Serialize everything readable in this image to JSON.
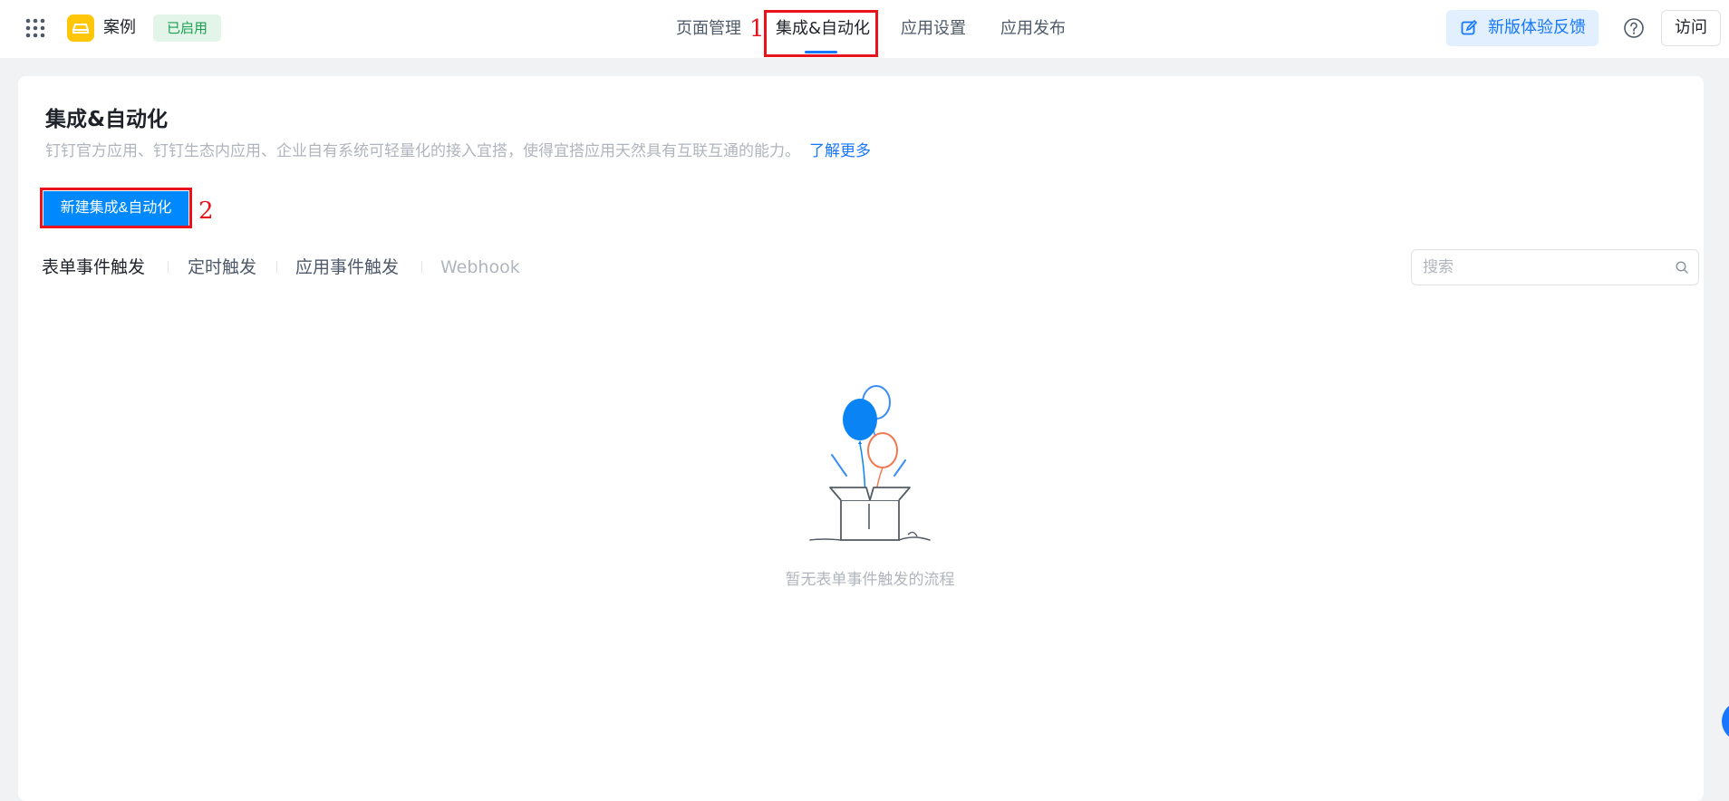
{
  "header": {
    "app_name": "案例",
    "status_badge": "已启用",
    "nav_tabs": [
      {
        "label": "页面管理"
      },
      {
        "label": "集成&自动化"
      },
      {
        "label": "应用设置"
      },
      {
        "label": "应用发布"
      }
    ],
    "feedback_label": "新版体验反馈",
    "visit_label": "访问"
  },
  "annotations": {
    "marker_1": "1",
    "marker_2": "2",
    "color": "#e8131d"
  },
  "main": {
    "title": "集成&自动化",
    "description": "钉钉官方应用、钉钉生态内应用、企业自有系统可轻量化的接入宜搭，使得宜搭应用天然具有互联互通的能力。",
    "learn_more": "了解更多",
    "create_button": "新建集成&自动化",
    "sub_tabs": [
      {
        "label": "表单事件触发"
      },
      {
        "label": "定时触发"
      },
      {
        "label": "应用事件触发"
      },
      {
        "label": "Webhook"
      }
    ],
    "search_placeholder": "搜索",
    "empty_text": "暂无表单事件触发的流程"
  },
  "colors": {
    "primary": "#0089ff",
    "link": "#1677ff",
    "status_green": "#1aa04f",
    "logo_yellow": "#ffc60a"
  },
  "icons": [
    "grid-icon",
    "app-logo-icon",
    "feedback-edit-icon",
    "help-icon",
    "search-icon",
    "balloon-box-illustration"
  ]
}
